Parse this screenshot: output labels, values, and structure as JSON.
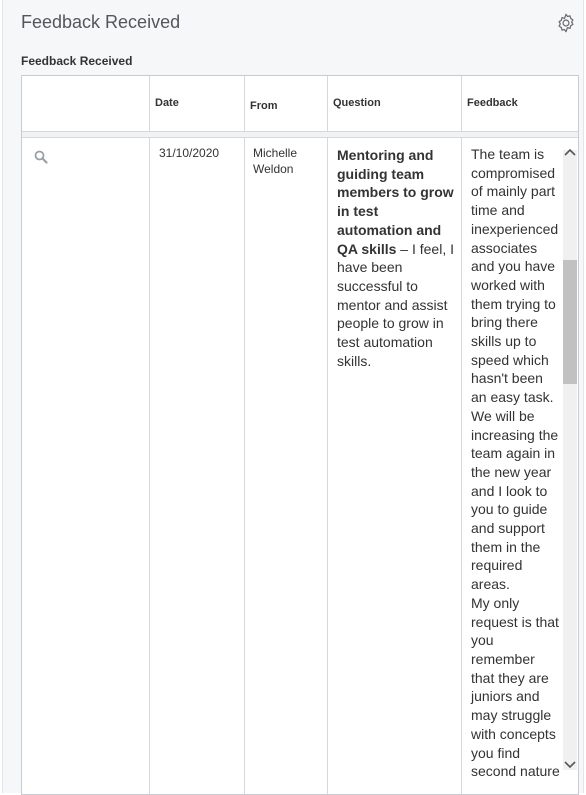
{
  "panel": {
    "title": "Feedback Received",
    "settings_icon": "gear-icon"
  },
  "section": {
    "title": "Feedback Received"
  },
  "table": {
    "columns": [
      "",
      "Date",
      "From",
      "Question",
      "Feedback"
    ],
    "rows": [
      {
        "action_icon": "search-icon",
        "date": "31/10/2020",
        "from": "Michelle Weldon",
        "question_bold": "Mentoring and guiding team members to grow in test automation and QA skills",
        "question_rest": " – I feel, I have been successful to mentor and assist people to grow in test automation skills.",
        "feedback": "The team is compromised of mainly part time and inexperienced associates and you have worked with them trying to bring there skills up to speed which hasn't been an easy task. We will be increasing the team again in the new year and I look to you to guide and support them in the required areas.\nMy only request is that you remember that they are juniors and may struggle with concepts you find second nature"
      }
    ]
  },
  "colors": {
    "panel_bg": "#f6f7f8",
    "border": "#c8ccd0",
    "text": "#333333"
  }
}
